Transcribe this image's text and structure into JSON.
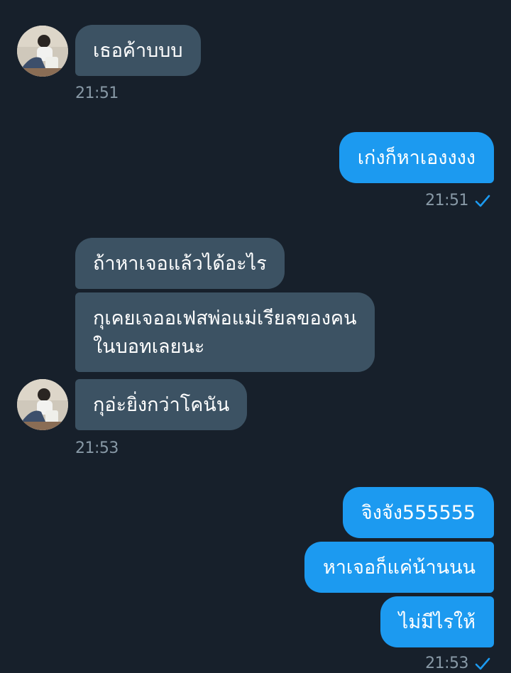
{
  "conversation": {
    "group1": {
      "messages": [
        "เธอค้าบบบ"
      ],
      "time": "21:51"
    },
    "group2": {
      "messages": [
        "เก่งก็หาเองงงง"
      ],
      "time": "21:51"
    },
    "group3": {
      "messages": [
        "ถ้าหาเจอแล้วได้อะไร",
        "กุเคยเจออเฟสพ่อแม่เรียลของคนในบอทเลยนะ",
        "กุอ่ะยิ่งกว่าโคนัน"
      ],
      "time": "21:53"
    },
    "group4": {
      "messages": [
        "จิงจัง555555",
        "หาเจอก็แค่น้านนน",
        "ไม่มีไรให้"
      ],
      "time": "21:53"
    }
  },
  "icons": {
    "avatar": "user-avatar-photo",
    "read_receipt": "checkmark-icon"
  },
  "colors": {
    "background": "#17202b",
    "received_bubble": "#3c5263",
    "sent_bubble": "#1c9af0",
    "timestamp": "#8899a6",
    "check": "#1c9af0",
    "text": "#ffffff"
  }
}
